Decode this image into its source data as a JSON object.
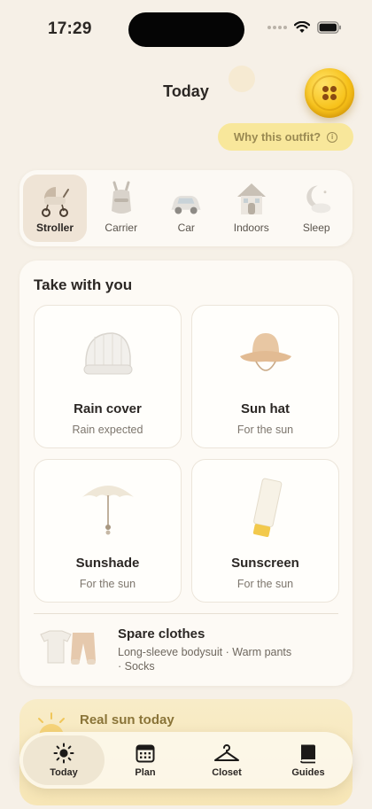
{
  "status": {
    "time": "17:29"
  },
  "header": {
    "title": "Today",
    "why_label": "Why this outfit?"
  },
  "modes": [
    {
      "label": "Stroller",
      "icon": "stroller-icon",
      "active": true
    },
    {
      "label": "Carrier",
      "icon": "carrier-icon",
      "active": false
    },
    {
      "label": "Car",
      "icon": "car-icon",
      "active": false
    },
    {
      "label": "Indoors",
      "icon": "house-icon",
      "active": false
    },
    {
      "label": "Sleep",
      "icon": "moon-icon",
      "active": false
    }
  ],
  "take": {
    "title": "Take with you",
    "items": [
      {
        "name": "Rain cover",
        "note": "Rain expected",
        "icon": "rain-cover-icon"
      },
      {
        "name": "Sun hat",
        "note": "For the sun",
        "icon": "sun-hat-icon"
      },
      {
        "name": "Sunshade",
        "note": "For the sun",
        "icon": "sunshade-icon"
      },
      {
        "name": "Sunscreen",
        "note": "For the sun",
        "icon": "sunscreen-icon"
      }
    ],
    "spare": {
      "title": "Spare clothes",
      "desc": "Long-sleeve bodysuit · Warm pants · Socks",
      "icon": "spare-clothes-icon"
    }
  },
  "sun_card": {
    "title": "Real sun today"
  },
  "tabs": [
    {
      "label": "Today",
      "icon": "sun-icon",
      "active": true
    },
    {
      "label": "Plan",
      "icon": "calendar-icon",
      "active": false
    },
    {
      "label": "Closet",
      "icon": "hanger-icon",
      "active": false
    },
    {
      "label": "Guides",
      "icon": "book-icon",
      "active": false
    }
  ],
  "colors": {
    "background": "#f6f0e7",
    "accent_yellow": "#f7c21a",
    "pill": "#f8e79b"
  }
}
